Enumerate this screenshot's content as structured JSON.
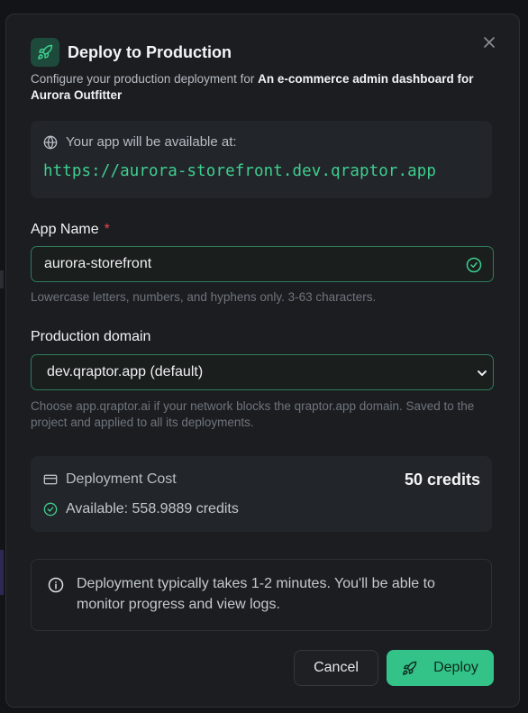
{
  "dialog": {
    "title": "Deploy to Production",
    "subtitle_prefix": "Configure your production deployment for ",
    "project_name": "An e-commerce admin dashboard for Aurora Outfitter"
  },
  "url_box": {
    "label": "Your app will be available at:",
    "url": "https://aurora-storefront.dev.qraptor.app"
  },
  "app_name": {
    "label": "App Name",
    "required_mark": "*",
    "value": "aurora-storefront",
    "help": "Lowercase letters, numbers, and hyphens only. 3-63 characters."
  },
  "domain": {
    "label": "Production domain",
    "selected": "dev.qraptor.app (default)",
    "help": "Choose app.qraptor.ai if your network blocks the qraptor.app domain. Saved to the project and applied to all its deployments."
  },
  "cost": {
    "title": "Deployment Cost",
    "amount": "50 credits",
    "available": "Available: 558.9889 credits"
  },
  "info": {
    "text": "Deployment typically takes 1-2 minutes. You'll be able to monitor progress and view logs."
  },
  "actions": {
    "cancel_label": "Cancel",
    "deploy_label": "Deploy"
  },
  "colors": {
    "accent": "#33c389",
    "url_text": "#3ecf8e",
    "required": "#e5484d",
    "background": "#1b1d21"
  },
  "icons": {
    "close": "close-icon",
    "header": "rocket-icon",
    "url": "globe-icon",
    "valid": "check-circle-icon",
    "select": "chevron-down-icon",
    "cost": "credit-card-icon",
    "available": "check-circle-icon",
    "info": "info-icon",
    "deploy": "rocket-icon"
  }
}
